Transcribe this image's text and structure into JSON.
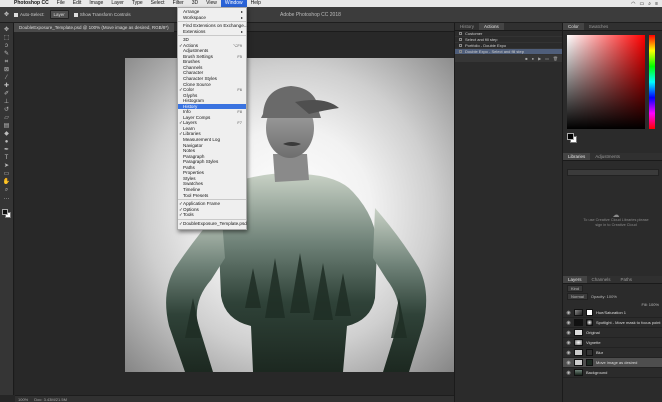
{
  "macbar": {
    "app_name": "Photoshop CC",
    "menus": [
      "File",
      "Edit",
      "Image",
      "Layer",
      "Type",
      "Select",
      "Filter",
      "3D",
      "View",
      "Window",
      "Help"
    ],
    "active_menu": "Window"
  },
  "app_title": "Adobe Photoshop CC 2018",
  "options_bar": {
    "auto_select_label": "Auto-Select:",
    "auto_select_value": "Layer",
    "transform_controls_label": "Show Transform Controls"
  },
  "document_tab": {
    "label": "DoubleExposure_Template.psd @ 100% (Move image as desired, RGB/8*)"
  },
  "window_menu": {
    "items": [
      {
        "label": "Arrange",
        "submenu": true
      },
      {
        "label": "Workspace",
        "submenu": true
      },
      {
        "sep": true
      },
      {
        "label": "Find Extensions on Exchange..."
      },
      {
        "label": "Extensions",
        "submenu": true
      },
      {
        "sep": true
      },
      {
        "label": "3D"
      },
      {
        "label": "Actions",
        "checked": true,
        "shortcut": "⌥F9"
      },
      {
        "label": "Adjustments"
      },
      {
        "label": "Brush Settings",
        "shortcut": "F5"
      },
      {
        "label": "Brushes"
      },
      {
        "label": "Channels"
      },
      {
        "label": "Character"
      },
      {
        "label": "Character Styles"
      },
      {
        "label": "Clone Source"
      },
      {
        "label": "Color",
        "checked": true,
        "shortcut": "F6"
      },
      {
        "label": "Glyphs"
      },
      {
        "label": "Histogram"
      },
      {
        "label": "History",
        "highlighted": true
      },
      {
        "label": "Info",
        "shortcut": "F8"
      },
      {
        "label": "Layer Comps"
      },
      {
        "label": "Layers",
        "checked": true,
        "shortcut": "F7"
      },
      {
        "label": "Learn"
      },
      {
        "label": "Libraries",
        "checked": true
      },
      {
        "label": "Measurement Log"
      },
      {
        "label": "Navigator"
      },
      {
        "label": "Notes"
      },
      {
        "label": "Paragraph"
      },
      {
        "label": "Paragraph Styles"
      },
      {
        "label": "Paths"
      },
      {
        "label": "Properties"
      },
      {
        "label": "Styles"
      },
      {
        "label": "Swatches"
      },
      {
        "label": "Timeline"
      },
      {
        "label": "Tool Presets"
      },
      {
        "sep": true
      },
      {
        "label": "Application Frame",
        "checked": true
      },
      {
        "label": "Options",
        "checked": true
      },
      {
        "label": "Tools",
        "checked": true
      },
      {
        "sep": true
      },
      {
        "label": "DoubleExposure_Template.psd",
        "checked": true
      }
    ]
  },
  "history_actions_panel": {
    "tabs": [
      "History",
      "Actions"
    ],
    "active_tab": "Actions",
    "rows": [
      "Customer",
      "Select and fill step",
      "Portfolio - Double Expo",
      "Double Expo - Select and fill step"
    ]
  },
  "color_panel": {
    "tabs": [
      "Color",
      "Swatches"
    ],
    "active_tab": "Color",
    "hue_color": "#ff0000"
  },
  "libraries_panel": {
    "tabs": [
      "Libraries",
      "Adjustments"
    ],
    "active_tab": "Libraries",
    "message": "To use Creative Cloud Libraries please sign in to Creative Cloud"
  },
  "layers_panel": {
    "tabs": [
      "Layers",
      "Channels",
      "Paths"
    ],
    "active_tab": "Layers",
    "kind_label": "Kind",
    "blend_mode": "Normal",
    "opacity_label": "Opacity: 100%",
    "fill_label": "Fill: 100%",
    "layers": [
      {
        "name": "Hue/Saturation 1",
        "selected": false
      },
      {
        "name": "Spotlight - Move mask to focus point",
        "selected": false
      },
      {
        "name": "Original",
        "selected": false
      },
      {
        "name": "Vignette",
        "selected": false
      },
      {
        "name": "Blur",
        "selected": false
      },
      {
        "name": "Move image as desired",
        "selected": true
      },
      {
        "name": "Background",
        "selected": false
      }
    ]
  },
  "status_bar": {
    "zoom": "100%",
    "doc_info": "Doc: 3.43M/21.5M"
  }
}
